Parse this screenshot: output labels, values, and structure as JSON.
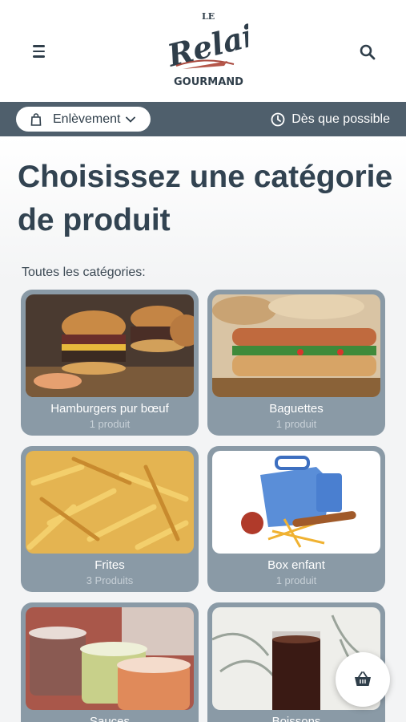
{
  "header": {
    "menu_icon": "hamburger-menu-icon",
    "search_icon": "search-icon",
    "logo": {
      "top": "LE",
      "main": "Relais",
      "bottom": "GOURMAND"
    }
  },
  "order_bar": {
    "mode_label": "Enlèvement",
    "mode_icon": "shopping-bag-icon",
    "time_label": "Dès que possible",
    "time_icon": "clock-icon"
  },
  "main": {
    "title": "Choisissez une catégorie de produit",
    "subtitle": "Toutes les catégories:",
    "categories": [
      {
        "name": "Hamburgers pur bœuf",
        "count": "1 produit"
      },
      {
        "name": "Baguettes",
        "count": "1 produit"
      },
      {
        "name": "Frites",
        "count": "3 Produits"
      },
      {
        "name": "Box enfant",
        "count": "1 produit"
      },
      {
        "name": "Sauces",
        "count": ""
      },
      {
        "name": "Boissons",
        "count": ""
      }
    ]
  },
  "cart": {
    "icon": "basket-icon"
  },
  "colors": {
    "bar": "#4f5f6c",
    "card": "#8a9aa6",
    "title": "#324351"
  }
}
